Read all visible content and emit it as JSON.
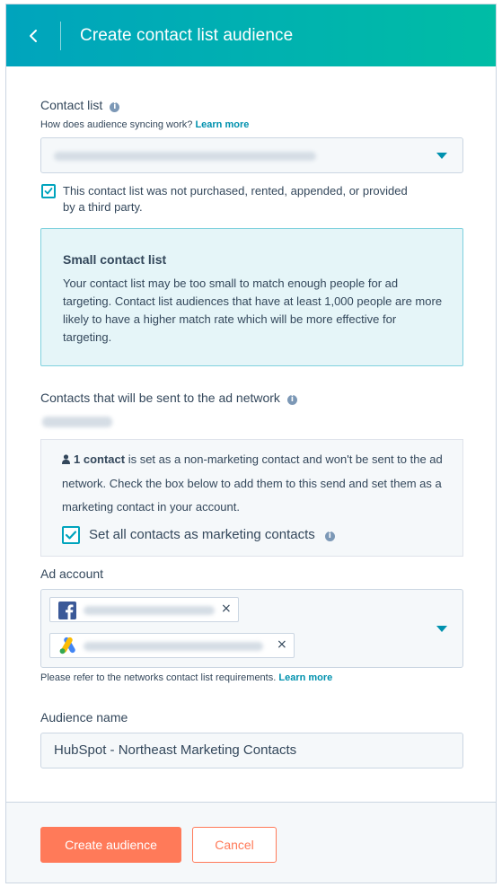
{
  "header": {
    "title": "Create contact list audience",
    "back_icon": "chevron-left-icon",
    "gradient_colors": [
      "#00a4bd",
      "#00bda5"
    ]
  },
  "contact_list": {
    "label": "Contact list",
    "help_text": "How does audience syncing work?",
    "help_link": "Learn more",
    "dropdown_icon": "caret-down-icon"
  },
  "third_party_checkbox": {
    "checked": true,
    "line1": "This contact list was not purchased, rented, appended, or provided",
    "line2": "by a third party."
  },
  "alert": {
    "title": "Small contact list",
    "body": "Your contact list may be too small to match enough people for ad targeting. Contact list audiences that have at least 1,000 people are more likely to have a higher match rate which will be more effective for targeting."
  },
  "contacts_sent": {
    "label": "Contacts that will be sent to the ad network"
  },
  "non_marketing": {
    "count_text": "1 contact",
    "message_rest": " is set as a non-marketing contact and won't be sent to the ad network. Check the box below to add them to this send and set them as a marketing contact in your account.",
    "checkbox_label": "Set all contacts as marketing contacts",
    "checkbox_checked": true
  },
  "ad_account": {
    "label": "Ad account",
    "accounts": [
      {
        "network": "facebook",
        "icon": "facebook-icon"
      },
      {
        "network": "google-ads",
        "icon": "google-ads-icon"
      }
    ],
    "note": "Please refer to the networks contact list requirements.",
    "note_link": "Learn more"
  },
  "audience_name": {
    "label": "Audience name",
    "value": "HubSpot - Northeast Marketing Contacts"
  },
  "footer": {
    "create_label": "Create audience",
    "cancel_label": "Cancel",
    "accent_color": "#ff7a59"
  }
}
